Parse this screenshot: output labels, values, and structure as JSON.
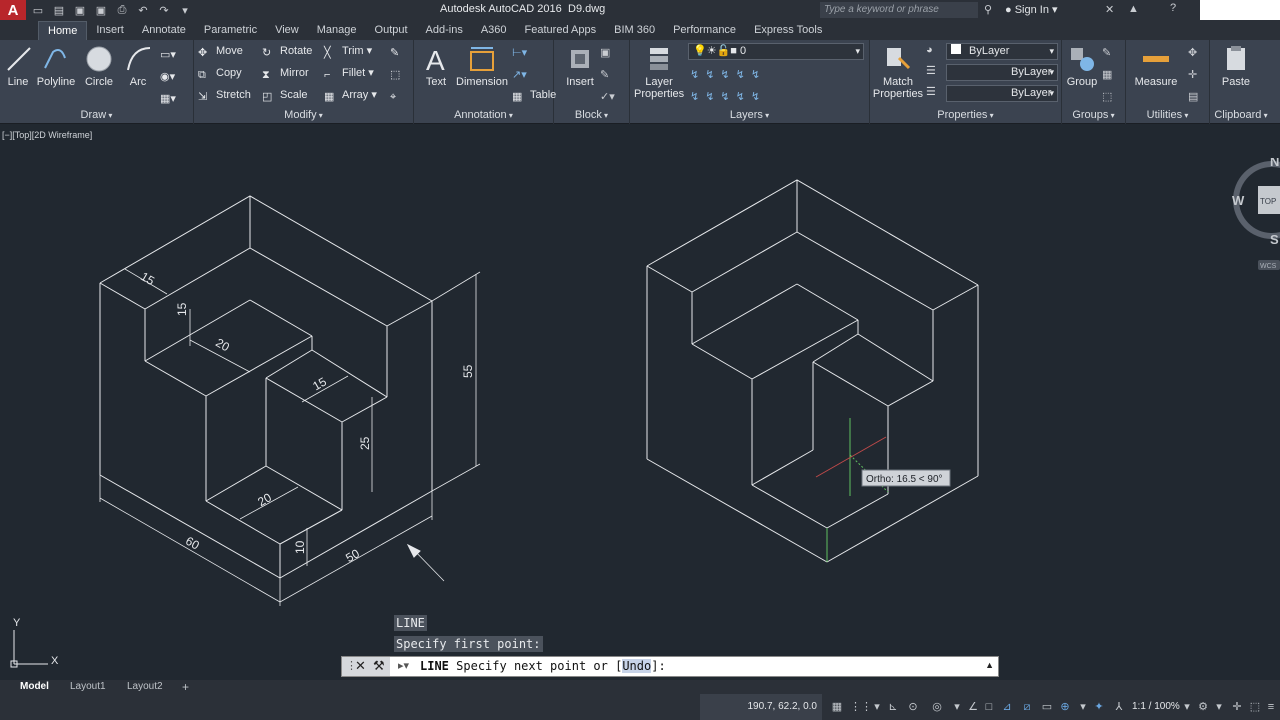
{
  "app": {
    "title": "Autodesk AutoCAD 2016",
    "file": "D9.dwg",
    "search_placeholder": "Type a keyword or phrase",
    "signin": "Sign In"
  },
  "tabs": [
    "Home",
    "Insert",
    "Annotate",
    "Parametric",
    "View",
    "Manage",
    "Output",
    "Add-ins",
    "A360",
    "Featured Apps",
    "BIM 360",
    "Performance",
    "Express Tools"
  ],
  "ribbon": {
    "draw": {
      "label": "Draw",
      "line": "Line",
      "polyline": "Polyline",
      "circle": "Circle",
      "arc": "Arc"
    },
    "modify": {
      "label": "Modify",
      "move": "Move",
      "rotate": "Rotate",
      "trim": "Trim",
      "copy": "Copy",
      "mirror": "Mirror",
      "fillet": "Fillet",
      "stretch": "Stretch",
      "scale": "Scale",
      "array": "Array"
    },
    "annotation": {
      "label": "Annotation",
      "text": "Text",
      "dimension": "Dimension",
      "table": "Table"
    },
    "block": {
      "label": "Block",
      "insert": "Insert"
    },
    "layers": {
      "label": "Layers",
      "layer_properties_1": "Layer",
      "layer_properties_2": "Properties",
      "current_layer": "0"
    },
    "properties": {
      "label": "Properties",
      "match_1": "Match",
      "match_2": "Properties",
      "color": "ByLayer",
      "linetype": "ByLayer",
      "lineweight": "ByLayer"
    },
    "groups": {
      "label": "Groups",
      "group": "Group"
    },
    "utilities": {
      "label": "Utilities",
      "measure": "Measure"
    },
    "clipboard": {
      "label": "Clipboard",
      "paste": "Paste"
    }
  },
  "viewport": {
    "label": "[−][Top][2D Wireframe]",
    "viewcube": {
      "n": "N",
      "w": "W",
      "s": "S",
      "top": "TOP",
      "wcs": "WCS"
    }
  },
  "drawing": {
    "dims": {
      "d15a": "15",
      "d15b": "15",
      "d20a": "20",
      "d15c": "15",
      "d55": "55",
      "d25": "25",
      "d20b": "20",
      "d10": "10",
      "d60": "60",
      "d50": "50"
    },
    "ortho_tooltip": "Ortho: 16.5 < 90°",
    "ucs_x": "X",
    "ucs_y": "Y"
  },
  "command": {
    "history_1": "LINE",
    "history_2": "Specify first point:",
    "prompt_cmd": "LINE",
    "prompt_text": "Specify next point or [",
    "prompt_undo": "Undo",
    "prompt_end": "]:"
  },
  "layout_tabs": [
    "Model",
    "Layout1",
    "Layout2"
  ],
  "status": {
    "coords": "190.7, 62.2, 0.0",
    "zoom": "1:1 / 100%"
  },
  "colors": {
    "background": "#212830",
    "ribbon": "#3b4350",
    "lines": "#e6e8eb",
    "accent": "#b8262b"
  }
}
